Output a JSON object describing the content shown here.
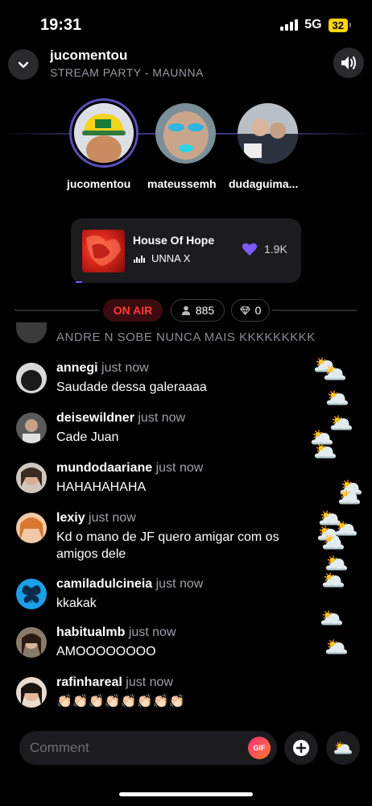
{
  "status": {
    "time": "19:31",
    "network": "5G",
    "battery": "32"
  },
  "header": {
    "title": "jucomentou",
    "subtitle": "STREAM PARTY - MAUNNA"
  },
  "guests": [
    "jucomentou",
    "mateussemh",
    "dudaguima..."
  ],
  "now_playing": {
    "title": "House Of Hope",
    "artist": "UNNA X",
    "likes": "1.9K"
  },
  "stats": {
    "on_air": "ON AIR",
    "listeners": "885",
    "gems": "0"
  },
  "chat": {
    "ghost_message": "ANDRE N SOBE NUNCA MAIS KKKKKKKKK",
    "messages": [
      {
        "user": "annegi",
        "time": "just now",
        "text": "Saudade dessa galeraaaa"
      },
      {
        "user": "deisewildner",
        "time": "just now",
        "text": "Cade Juan"
      },
      {
        "user": "mundodaariane",
        "time": "just now",
        "text": "HAHAHAHAHA"
      },
      {
        "user": "lexiy",
        "time": "just now",
        "text": "Kd o mano de JF quero amigar com os amigos dele"
      },
      {
        "user": "camiladulcineia",
        "time": "just now",
        "text": "kkakak"
      },
      {
        "user": "habitualmb",
        "time": "just now",
        "text": "AMOOOOOOOO"
      },
      {
        "user": "rafinhareal",
        "time": "just now",
        "text": "👏🏻👏🏻👏🏻👏🏻👏🏻👏🏻👏🏻👏🏻"
      }
    ]
  },
  "reaction_emoji": "🌥️",
  "composer": {
    "placeholder": "Comment",
    "gif_label": "GIF"
  },
  "colors": {
    "accent": "#6a5cff",
    "on_air": "#ff3b3b",
    "like": "#7b5cff"
  }
}
